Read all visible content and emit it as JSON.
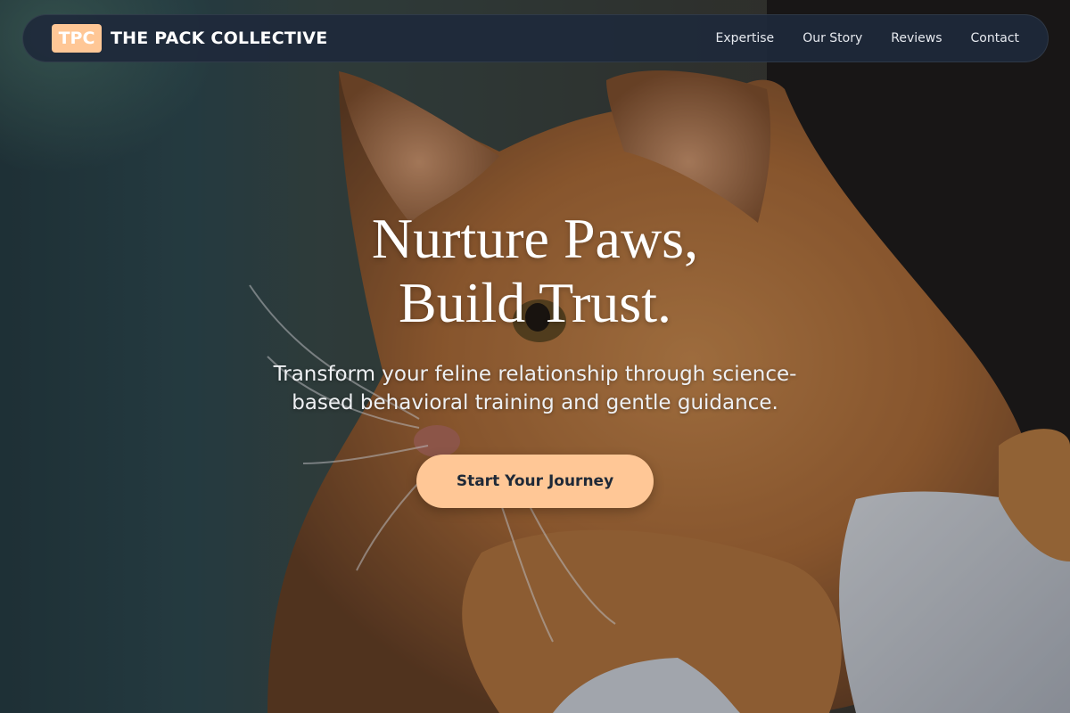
{
  "brand": {
    "badge": "TPC",
    "name": "THE PACK COLLECTIVE",
    "badge_color": "#ffc796"
  },
  "nav": {
    "links": [
      {
        "label": "Expertise"
      },
      {
        "label": "Our Story"
      },
      {
        "label": "Reviews"
      },
      {
        "label": "Contact"
      }
    ]
  },
  "hero": {
    "title_line1": "Nurture Paws,",
    "title_line2": "Build Trust.",
    "subtitle": "Transform your feline relationship through science-based behavioral training and gentle guidance.",
    "cta_label": "Start Your Journey",
    "background_image": "orange-tabby-cat-photo",
    "accent_color": "#ffc796"
  }
}
